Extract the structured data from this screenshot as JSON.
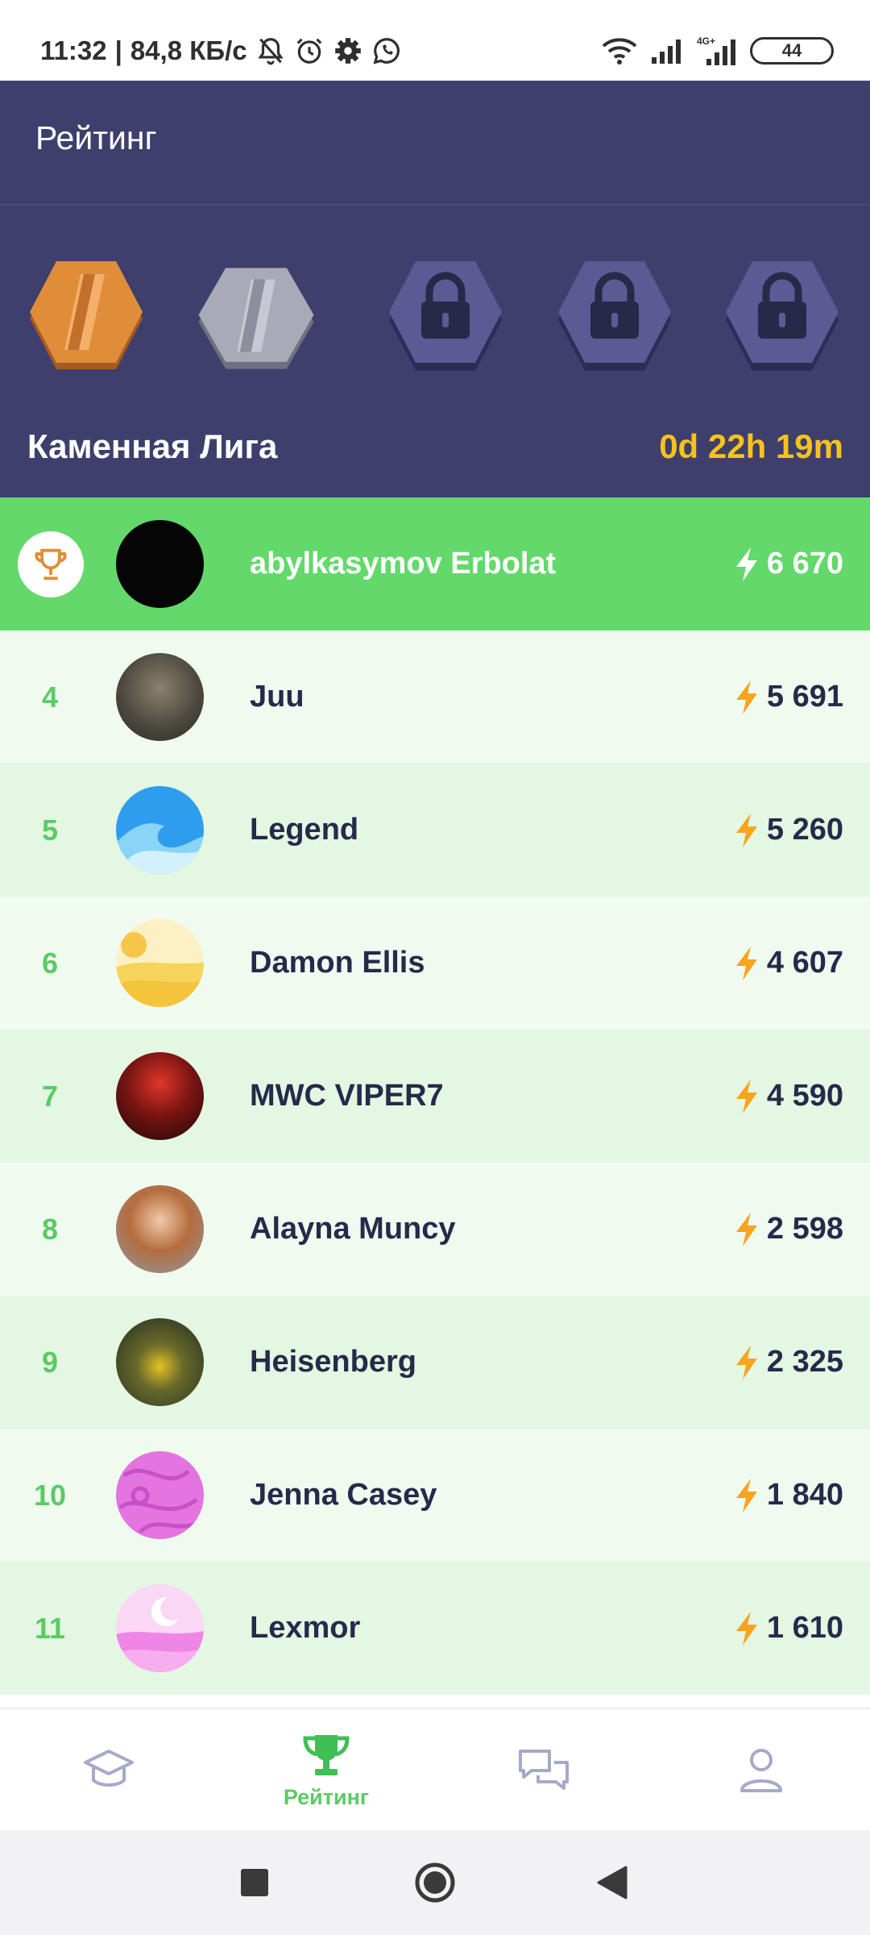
{
  "status_bar": {
    "time": "11:32",
    "network_speed": "84,8 КБ/с",
    "battery": "44",
    "icons": [
      "mute-bell-icon",
      "alarm-icon",
      "gear-icon",
      "whatsapp-icon",
      "wifi-icon",
      "signal-icon",
      "4g-signal-icon"
    ]
  },
  "header": {
    "title": "Рейтинг",
    "league_name": "Каменная Лига",
    "timer": "0d 22h 19m",
    "leagues": [
      {
        "name": "bronze-league",
        "state": "unlocked",
        "color": "#e08d3a"
      },
      {
        "name": "silver-league",
        "state": "unlocked",
        "color": "#a9a9b7"
      },
      {
        "name": "locked-league-3",
        "state": "locked"
      },
      {
        "name": "locked-league-4",
        "state": "locked"
      },
      {
        "name": "locked-league-5",
        "state": "locked"
      }
    ]
  },
  "leaderboard": {
    "current_user": {
      "name": "abylkasymov Erbolat",
      "score": "6 670"
    },
    "rows": [
      {
        "rank": "4",
        "name": "Juu",
        "score": "5 691"
      },
      {
        "rank": "5",
        "name": "Legend",
        "score": "5 260"
      },
      {
        "rank": "6",
        "name": "Damon Ellis",
        "score": "4 607"
      },
      {
        "rank": "7",
        "name": "MWC VIPER7",
        "score": "4 590"
      },
      {
        "rank": "8",
        "name": "Alayna Muncy",
        "score": "2 598"
      },
      {
        "rank": "9",
        "name": "Heisenberg",
        "score": "2 325"
      },
      {
        "rank": "10",
        "name": "Jenna Casey",
        "score": "1 840"
      },
      {
        "rank": "11",
        "name": "Lexmor",
        "score": "1 610"
      }
    ]
  },
  "tabs": {
    "active_label": "Рейтинг",
    "items": [
      "learn-tab",
      "rating-tab",
      "chat-tab",
      "profile-tab"
    ]
  },
  "colors": {
    "header_bg": "#3f3f6d",
    "accent_green": "#62d96a",
    "timer_yellow": "#f6c31d",
    "bolt_orange": "#f7a51c"
  }
}
